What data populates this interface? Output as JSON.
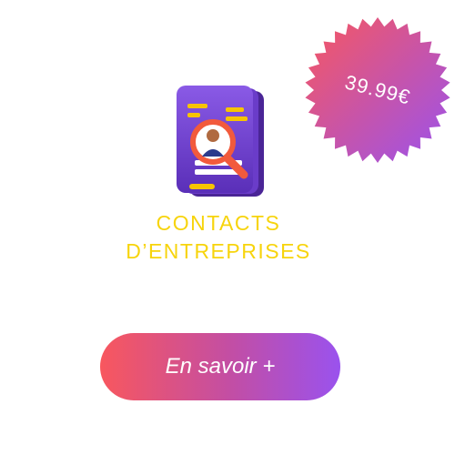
{
  "price": {
    "label": "39.99€"
  },
  "product": {
    "title_line1": "CONTACTS",
    "title_line2": "D’ENTREPRISES",
    "icon": "document-search-contact-icon"
  },
  "cta": {
    "label": "En savoir +"
  },
  "colors": {
    "title": "#f7d40c",
    "gradient_start": "#f8575e",
    "gradient_end": "#9a52ee",
    "icon_purple": "#6c3fd0"
  }
}
